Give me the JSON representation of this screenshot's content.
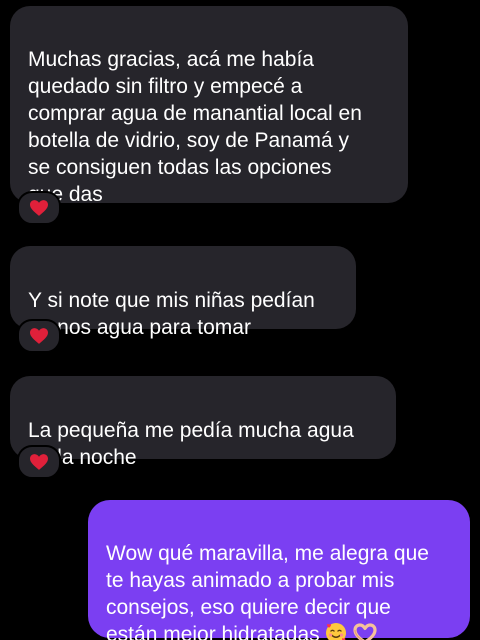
{
  "messages": [
    {
      "direction": "incoming",
      "text": "Muchas gracias, acá me había\nquedado sin filtro y empecé a\ncomprar agua de manantial local en\nbotella de vidrio, soy de Panamá y\nse consiguen todas las opciones\nque das",
      "reaction": "red-heart"
    },
    {
      "direction": "incoming",
      "text": "Y si note que mis niñas pedían\nmenos agua para tomar",
      "reaction": "red-heart"
    },
    {
      "direction": "incoming",
      "text": "La pequeña me pedía mucha agua\nen la noche",
      "reaction": "red-heart"
    },
    {
      "direction": "outgoing",
      "text": "Wow qué maravilla, me alegra que\nte hayas animado a probar mis\nconsejos, eso quiere decir que\nestán mejor hidratadas",
      "emojis": [
        "smiling-face-with-hearts",
        "heart-hands"
      ]
    }
  ],
  "colors": {
    "background": "#000000",
    "incoming_bubble": "#26252b",
    "outgoing_bubble": "#7b3ff2",
    "heart": "#e0203a"
  }
}
